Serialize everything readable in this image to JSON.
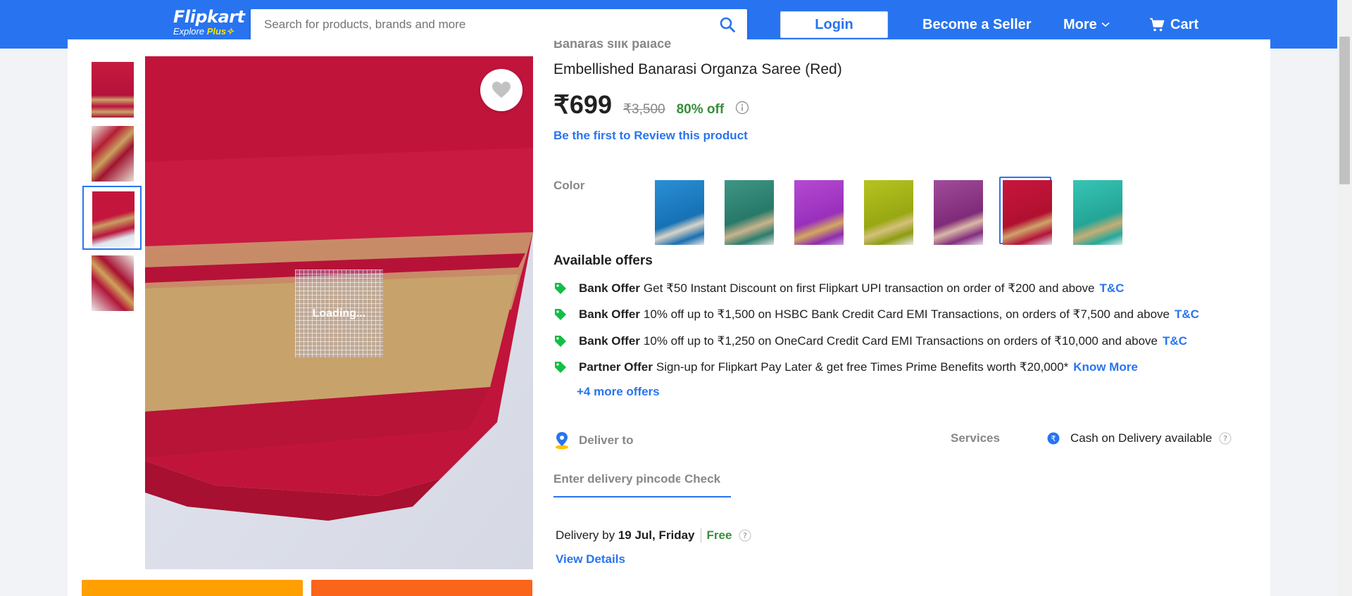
{
  "header": {
    "logo_text": "Flipkart",
    "logo_sub": "Explore",
    "logo_plus": "Plus",
    "search_placeholder": "Search for products, brands and more",
    "login": "Login",
    "become_seller": "Become a Seller",
    "more": "More",
    "cart": "Cart",
    "color": "#2874f0"
  },
  "product": {
    "brand": "Banaras silk palace",
    "title": "Embellished Banarasi Organza Saree  (Red)",
    "price": "₹699",
    "mrp": "₹3,500",
    "discount": "80% off",
    "review_link": "Be the first to Review this product",
    "loading_text": "Loading..."
  },
  "color": {
    "label": "Color",
    "swatches": [
      {
        "name": "blue",
        "color": "#1e7fc4",
        "selected": false
      },
      {
        "name": "green",
        "color": "#2f8f7f",
        "selected": false
      },
      {
        "name": "purple",
        "color": "#a53cc4",
        "selected": false
      },
      {
        "name": "lime",
        "color": "#a6b61d",
        "selected": false
      },
      {
        "name": "magenta",
        "color": "#933d8f",
        "selected": false
      },
      {
        "name": "red",
        "color": "#c0143c",
        "selected": true
      },
      {
        "name": "teal",
        "color": "#2cb6a8",
        "selected": false
      }
    ]
  },
  "offers": {
    "title": "Available offers",
    "items": [
      {
        "kind": "Bank Offer",
        "text": "Get ₹50 Instant Discount on first Flipkart UPI transaction on order of ₹200 and above",
        "link": "T&C"
      },
      {
        "kind": "Bank Offer",
        "text": "10% off up to ₹1,500 on HSBC Bank Credit Card EMI Transactions, on orders of ₹7,500 and above",
        "link": "T&C"
      },
      {
        "kind": "Bank Offer",
        "text": "10% off up to ₹1,250 on OneCard Credit Card EMI Transactions on orders of ₹10,000 and above",
        "link": "T&C"
      },
      {
        "kind": "Partner Offer",
        "text": "Sign-up for Flipkart Pay Later & get free Times Prime Benefits worth ₹20,000*",
        "link": "Know More"
      }
    ],
    "more": "+4 more offers"
  },
  "delivery": {
    "label": "Deliver to",
    "pincode_placeholder": "Enter delivery pincode",
    "check": "Check",
    "by_label": "Delivery by",
    "date": "19 Jul, Friday",
    "free": "Free",
    "view_details": "View Details"
  },
  "services": {
    "label": "Services",
    "cod": "Cash on Delivery available"
  }
}
